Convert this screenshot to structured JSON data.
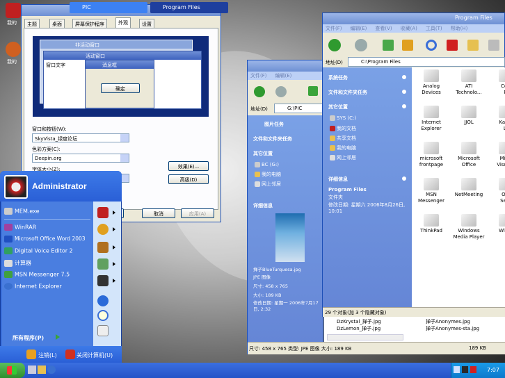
{
  "desktop": {
    "icon1_label": "我的",
    "icon2_label": "我的"
  },
  "display_props": {
    "title": "显示 属性",
    "tabs": [
      "主题",
      "桌面",
      "屏幕保护程序",
      "外观",
      "设置"
    ],
    "preview": {
      "inactive": "非活动窗口",
      "active": "活动窗口",
      "msgbox": "消息框",
      "window_text": "窗口文字",
      "ok": "确定"
    },
    "window_button_label": "窗口和按钮(W):",
    "window_button_value": "SkyVista_绿度论坛",
    "color_scheme_label": "色彩方案(C):",
    "color_scheme_value": "Deepin.org",
    "font_size_label": "字体大小(Z):",
    "effects_btn": "效果(E)...",
    "advanced_btn": "高级(D)",
    "ok_btn": "确定",
    "cancel_btn": "取消",
    "apply_btn": "应用(A)"
  },
  "start_menu": {
    "user": "Administrator",
    "pinned": [
      "MEM.exe",
      "WinRAR",
      "Microsoft Office Word 2003",
      "Digital Voice Editor 2",
      "计算器",
      "MSN Messenger 7.5",
      "Internet Explorer"
    ],
    "all_programs": "所有程序(P)",
    "logoff": "注销(L)",
    "shutdown": "关闭计算机(U)"
  },
  "pic_window": {
    "title": "PIC",
    "menu": [
      "文件(F)",
      "编辑(E)"
    ],
    "address_label": "地址(D)",
    "address": "G:\\PIC",
    "sections": {
      "picture_tasks": "图片任务",
      "file_tasks": "文件和文件夹任务",
      "other": "其它位置",
      "details": "详细信息"
    },
    "other_items": [
      "BC (G:)",
      "我的电脑",
      "网上邻居"
    ],
    "detail_name": "掸子BlueTurquesa.jpg",
    "detail_type": "JPE 图像",
    "detail_size": "尺寸: 458 x 765",
    "detail_bytes": "大小: 189 KB",
    "detail_date": "修改日期: 星期一 2006年7月17日, 2:32",
    "statusbar": "尺寸: 458 x 765 类型: JPE 图像 大小: 189 KB",
    "statusbar_right": "189 KB",
    "files": [
      "DzKrystal_掸子.jpg",
      "DzLemon_掸子.jpg",
      "掸子Anonymes.jpg",
      "掸子Anonymes-sta.jpg"
    ]
  },
  "pf_window": {
    "title": "Program Files",
    "menu": [
      "文件(F)",
      "编辑(E)",
      "查看(V)",
      "收藏(A)",
      "工具(T)",
      "帮助(H)"
    ],
    "address_label": "地址(D)",
    "address": "C:\\Program Files",
    "sections": {
      "system": "系统任务",
      "file_tasks": "文件和文件夹任务",
      "other": "其它位置",
      "details": "详细信息"
    },
    "other_items": [
      "SYS (C:)",
      "我的文档",
      "共享文档",
      "我的电脑",
      "网上邻居"
    ],
    "detail_name": "Program Files",
    "detail_type": "文件夹",
    "detail_date": "修改日期: 星期六 2006年8月26日, 10:01",
    "icons": [
      {
        "l1": "Analog",
        "l2": "Devices"
      },
      {
        "l1": "ATI",
        "l2": "Technolo..."
      },
      {
        "l1": "Com",
        "l2": "Fil"
      },
      {
        "l1": "Internet",
        "l2": "Explorer"
      },
      {
        "l1": "JJOL",
        "l2": ""
      },
      {
        "l1": "Kaspe",
        "l2": "La"
      },
      {
        "l1": "microsoft",
        "l2": "frontpage"
      },
      {
        "l1": "Microsoft",
        "l2": "Office"
      },
      {
        "l1": "Micro",
        "l2": "Visual S"
      },
      {
        "l1": "MSN",
        "l2": "Messenger"
      },
      {
        "l1": "NetMeeting",
        "l2": ""
      },
      {
        "l1": "Onli",
        "l2": "Servi"
      },
      {
        "l1": "ThinkPad",
        "l2": ""
      },
      {
        "l1": "Windows",
        "l2": "Media Player"
      },
      {
        "l1": "Windo",
        "l2": ""
      }
    ],
    "statusbar": "29 个对象(加 3 个隐藏对象)"
  },
  "taskbar": {
    "items": [
      "PIC",
      "Program Files"
    ],
    "clock": "7:07"
  },
  "colors": {
    "xp_blue": "#2453c7",
    "pane_blue": "#6586d6",
    "start_orange": "#f18533"
  }
}
